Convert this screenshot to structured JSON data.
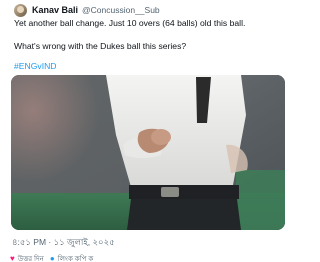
{
  "author": {
    "display_name": "Kanav Bali",
    "handle": "@Concussion__Sub"
  },
  "tweet": {
    "line1": "Yet another ball change. Just 10 overs (64 balls) old this ball.",
    "line2": "What's wrong with the Dukes ball this series?",
    "hashtag": "#ENGvIND",
    "timestamp": "৪:৫১ PM · ১১ জুলাই, ২০২৫"
  },
  "actions": {
    "like_label": "উত্তর দিন",
    "reply_label": "লিংক কপি ক"
  },
  "colors": {
    "link": "#1d9bf0",
    "heart": "#f91880",
    "secondary_text": "#536471"
  },
  "icons": {
    "like": "heart-icon",
    "reply": "reply-icon"
  }
}
